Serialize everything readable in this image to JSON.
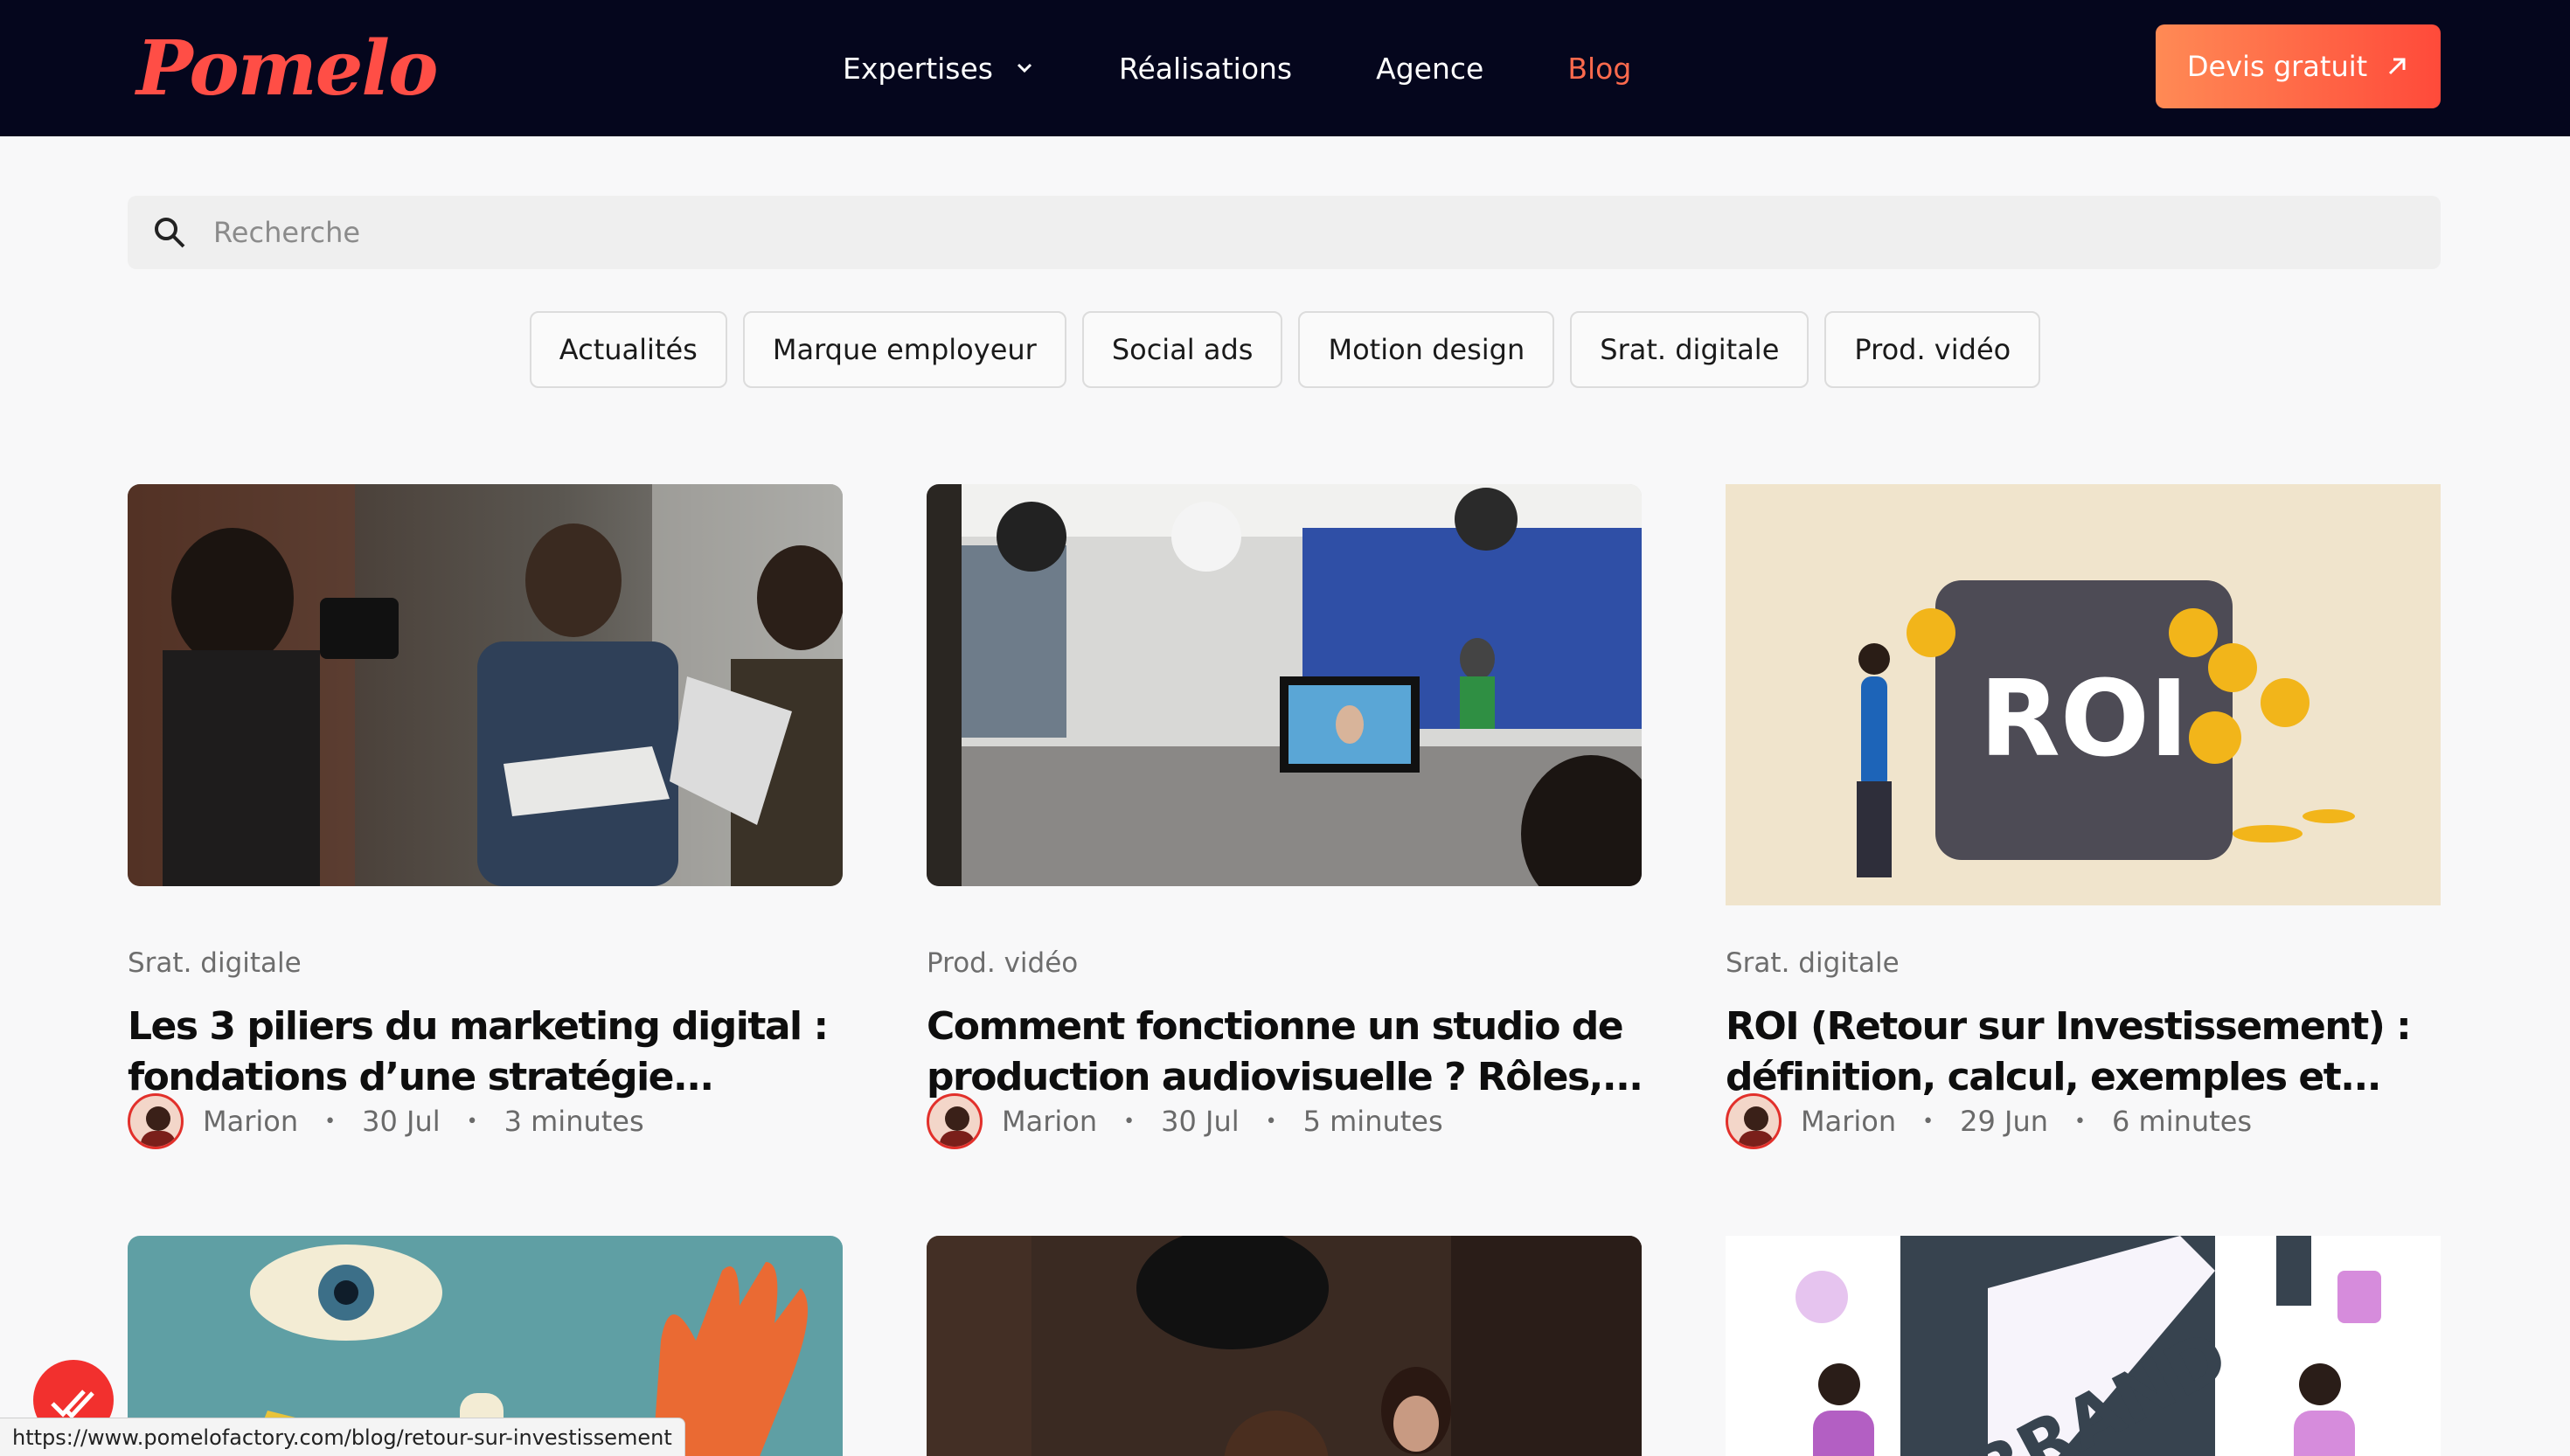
{
  "brand": {
    "logo": "Pomelo",
    "accent": "#ff5a45",
    "navbar_bg": "#05061d"
  },
  "nav": {
    "items": [
      {
        "label": "Expertises",
        "has_dropdown": true,
        "active": false
      },
      {
        "label": "Réalisations",
        "active": false
      },
      {
        "label": "Agence",
        "active": false
      },
      {
        "label": "Blog",
        "active": true
      }
    ],
    "cta_label": "Devis gratuit",
    "cta_icon": "arrow-up-right-icon"
  },
  "search": {
    "placeholder": "Recherche",
    "value": "",
    "icon": "search-icon"
  },
  "filters": [
    "Actualités",
    "Marque employeur",
    "Social ads",
    "Motion design",
    "Srat. digitale",
    "Prod. vidéo"
  ],
  "articles": [
    {
      "category": "Srat. digitale",
      "title_line1": "Les 3 piliers du marketing digital :",
      "title_line2": "fondations d’une stratégie...",
      "author": "Marion",
      "date": "30 Jul",
      "read_time": "3 minutes"
    },
    {
      "category": "Prod. vidéo",
      "title_line1": "Comment fonctionne un studio de",
      "title_line2": "production audiovisuelle ? Rôles,...",
      "author": "Marion",
      "date": "30 Jul",
      "read_time": "5 minutes"
    },
    {
      "category": "Srat. digitale",
      "title_line1": "ROI (Retour sur Investissement) :",
      "title_line2": "définition, calcul, exemples et...",
      "author": "Marion",
      "date": "29 Jun",
      "read_time": "6 minutes",
      "image_text": "ROI"
    },
    {
      "image": "eye-hand-illustration"
    },
    {
      "image": "video-shoot-photo"
    },
    {
      "image": "brand-isometric-illustration",
      "image_text": "BRAND"
    }
  ],
  "status_bar": {
    "url": "https://www.pomelofactory.com/blog/retour-sur-investissement"
  }
}
